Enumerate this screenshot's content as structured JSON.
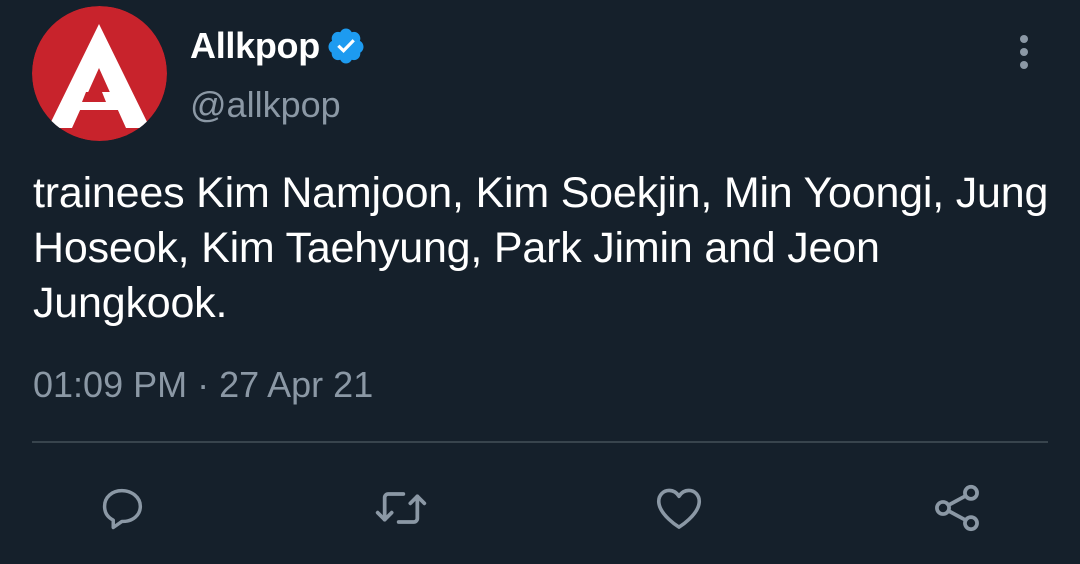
{
  "author": {
    "display_name": "Allkpop",
    "handle": "@allkpop",
    "verified": true,
    "avatar_icon": "allkpop-logo-icon"
  },
  "tweet": {
    "text": "trainees Kim Namjoon, Kim Soekjin, Min Yoongi, Jung Hoseok, Kim Taehyung, Park Jimin and Jeon Jungkook.",
    "time": "01:09 PM",
    "separator": "·",
    "date": "27 Apr 21"
  },
  "actions": [
    {
      "name": "reply",
      "icon": "comment-icon"
    },
    {
      "name": "retweet",
      "icon": "retweet-icon"
    },
    {
      "name": "like",
      "icon": "heart-icon"
    },
    {
      "name": "share",
      "icon": "share-icon"
    }
  ],
  "colors": {
    "background": "#15202b",
    "text": "#ffffff",
    "muted": "#8b98a5",
    "verified": "#1d9bf0",
    "avatar_red": "#c8232c",
    "divider": "#38444d"
  }
}
